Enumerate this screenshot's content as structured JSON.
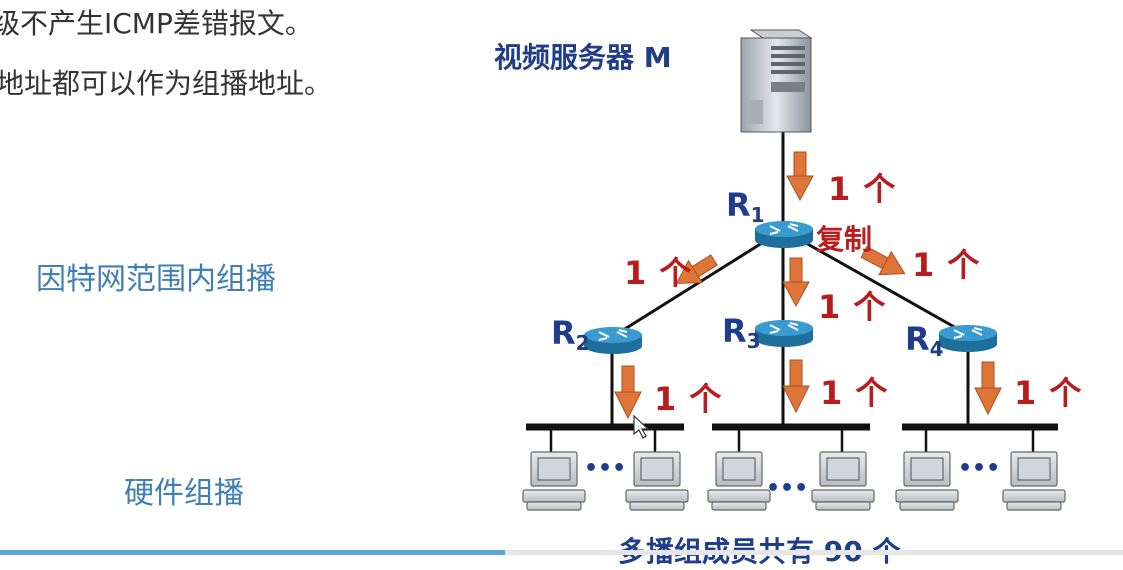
{
  "text_lines": [
    "级不产生ICMP差错报文。",
    "地址都可以作为组播地址。"
  ],
  "left_labels": {
    "internet_multicast": "因特网范围内组播",
    "hardware_multicast": "硬件组播"
  },
  "diagram": {
    "server_label": "视频服务器 M",
    "routers": [
      {
        "name": "R",
        "sub": "1"
      },
      {
        "name": "R",
        "sub": "2"
      },
      {
        "name": "R",
        "sub": "3"
      },
      {
        "name": "R",
        "sub": "4"
      }
    ],
    "copy_label": "复制",
    "count_label": "1 个",
    "ellipsis": "•••",
    "members_label": "多播组成员共有 90 个"
  },
  "video_progress": 0.45,
  "colors": {
    "router": "#3a9bd0",
    "arrow": "#e0753a",
    "count_text": "#b81c1c",
    "title_text": "#1f3d8a",
    "left_label": "#3f7fb5"
  }
}
